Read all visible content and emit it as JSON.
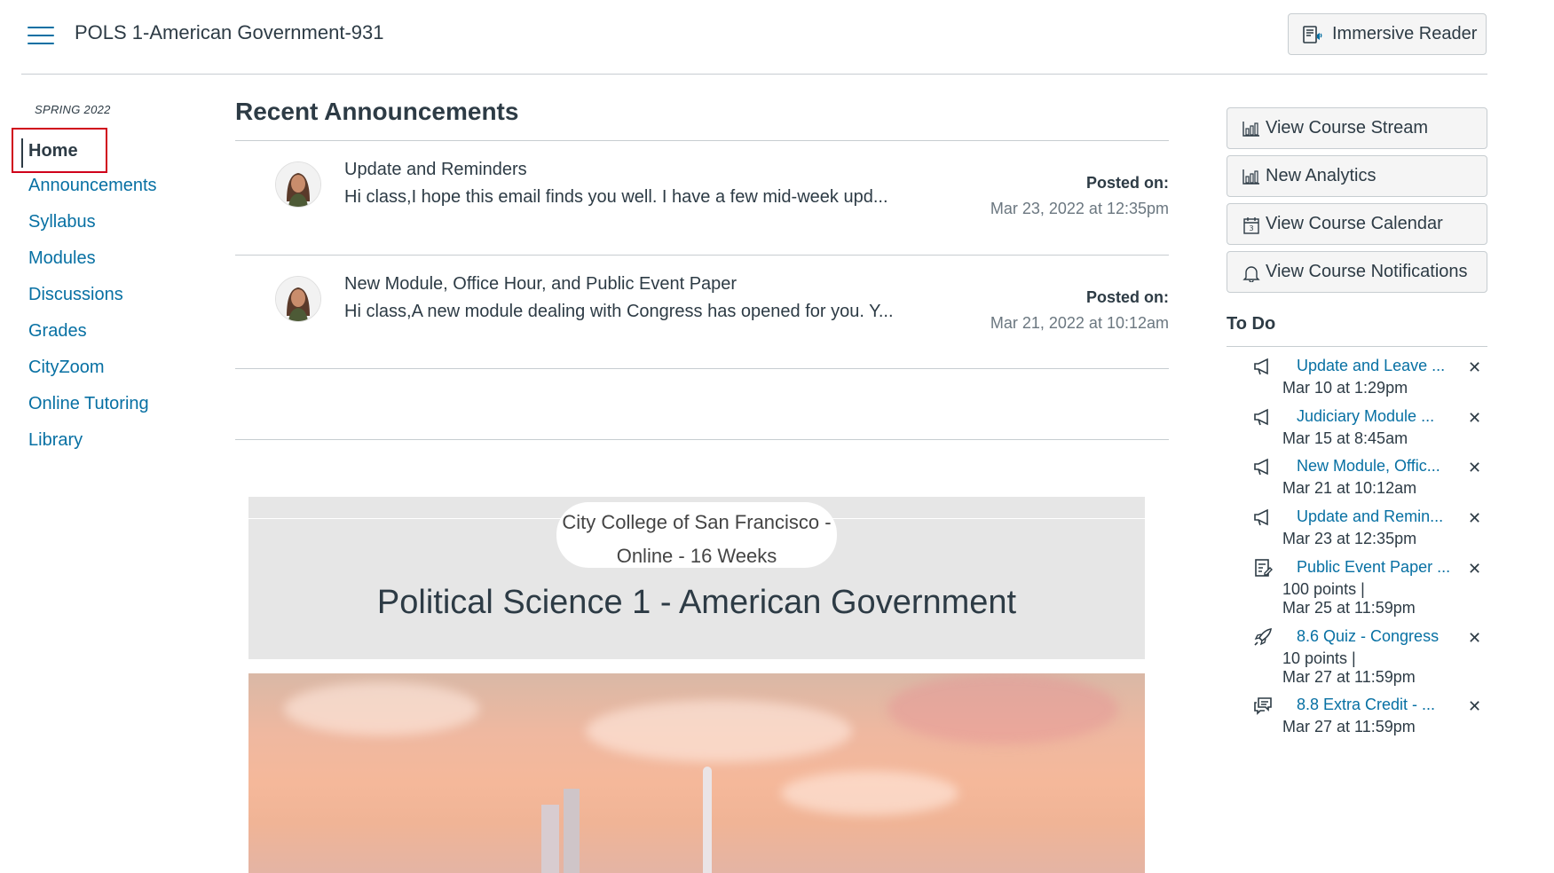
{
  "header": {
    "course_title": "POLS 1-American Government-931",
    "immersive_reader_label": "Immersive Reader"
  },
  "sidebar": {
    "term": "SPRING 2022",
    "items": [
      {
        "label": "Home"
      },
      {
        "label": "Announcements"
      },
      {
        "label": "Syllabus"
      },
      {
        "label": "Modules"
      },
      {
        "label": "Discussions"
      },
      {
        "label": "Grades"
      },
      {
        "label": "CityZoom"
      },
      {
        "label": "Online Tutoring"
      },
      {
        "label": "Library"
      }
    ]
  },
  "main": {
    "recent_announcements_title": "Recent Announcements",
    "announcements": [
      {
        "title": "Update and Reminders",
        "body": "Hi class,I hope this email finds you well.  I have a few mid-week upd...",
        "posted_label": "Posted on:",
        "posted_date": "Mar 23, 2022 at 12:35pm"
      },
      {
        "title": "New Module, Office Hour, and Public Event Paper",
        "body": "Hi class,A new module dealing with Congress has opened for you.  Y...",
        "posted_label": "Posted on:",
        "posted_date": "Mar 21, 2022 at 10:12am"
      }
    ],
    "banner": {
      "line1": "City College of San Francisco -",
      "line2": "Online - 16 Weeks",
      "title": "Political Science 1 - American Government"
    }
  },
  "right_sidebar": {
    "buttons": [
      {
        "label": "View Course Stream",
        "icon": "stream-icon"
      },
      {
        "label": "New Analytics",
        "icon": "analytics-icon"
      },
      {
        "label": "View Course Calendar",
        "icon": "calendar-icon"
      },
      {
        "label": "View Course Notifications",
        "icon": "bell-icon"
      }
    ],
    "todo_title": "To Do",
    "todo_items": [
      {
        "icon": "announcement-icon",
        "title": "Update and Leave ...",
        "line1": "Mar 10 at 1:29pm",
        "line2": ""
      },
      {
        "icon": "announcement-icon",
        "title": "Judiciary Module ...",
        "line1": "Mar 15 at 8:45am",
        "line2": ""
      },
      {
        "icon": "announcement-icon",
        "title": "New Module, Offic...",
        "line1": "Mar 21 at 10:12am",
        "line2": ""
      },
      {
        "icon": "announcement-icon",
        "title": "Update and Remin...",
        "line1": "Mar 23 at 12:35pm",
        "line2": ""
      },
      {
        "icon": "assignment-icon",
        "title": "Public Event Paper ...",
        "line1": "100 points  |",
        "line2": "Mar 25 at 11:59pm"
      },
      {
        "icon": "quiz-icon",
        "title": "8.6 Quiz - Congress",
        "line1": "10 points  |",
        "line2": "Mar 27 at 11:59pm"
      },
      {
        "icon": "discussion-icon",
        "title": "8.8 Extra Credit - ...",
        "line1": "Mar 27 at 11:59pm",
        "line2": ""
      }
    ],
    "dismiss_glyph": "✕"
  }
}
